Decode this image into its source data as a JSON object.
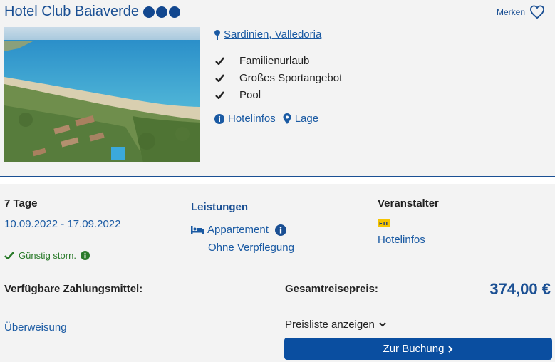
{
  "hotel": {
    "name": "Hotel Club Baiaverde",
    "stars": 3,
    "merken_label": "Merken",
    "location": "Sardinien, Valledoria",
    "features": [
      "Familienurlaub",
      "Großes Sportangebot",
      "Pool"
    ],
    "links": {
      "hotelinfos": "Hotelinfos",
      "lage": "Lage"
    }
  },
  "offer": {
    "duration": "7 Tage",
    "dates": "10.09.2022 - 17.09.2022",
    "storno": "Günstig storn.",
    "leistungen_title": "Leistungen",
    "room": "Appartement",
    "board": "Ohne Verpflegung",
    "veranstalter_title": "Veranstalter",
    "veranstalter_logo_text": "FTI",
    "veranstalter_link": "Hotelinfos"
  },
  "payment": {
    "title": "Verfügbare Zahlungsmittel:",
    "method": "Überweisung"
  },
  "price": {
    "label": "Gesamtreisepreis:",
    "value": "374,00 €",
    "pricelist_label": "Preisliste anzeigen",
    "book_label": "Zur Buchung"
  },
  "colors": {
    "brand": "#1a4f93",
    "link": "#1a5aa3",
    "button": "#0a4ea0",
    "storno_green": "#2a7a2a"
  }
}
